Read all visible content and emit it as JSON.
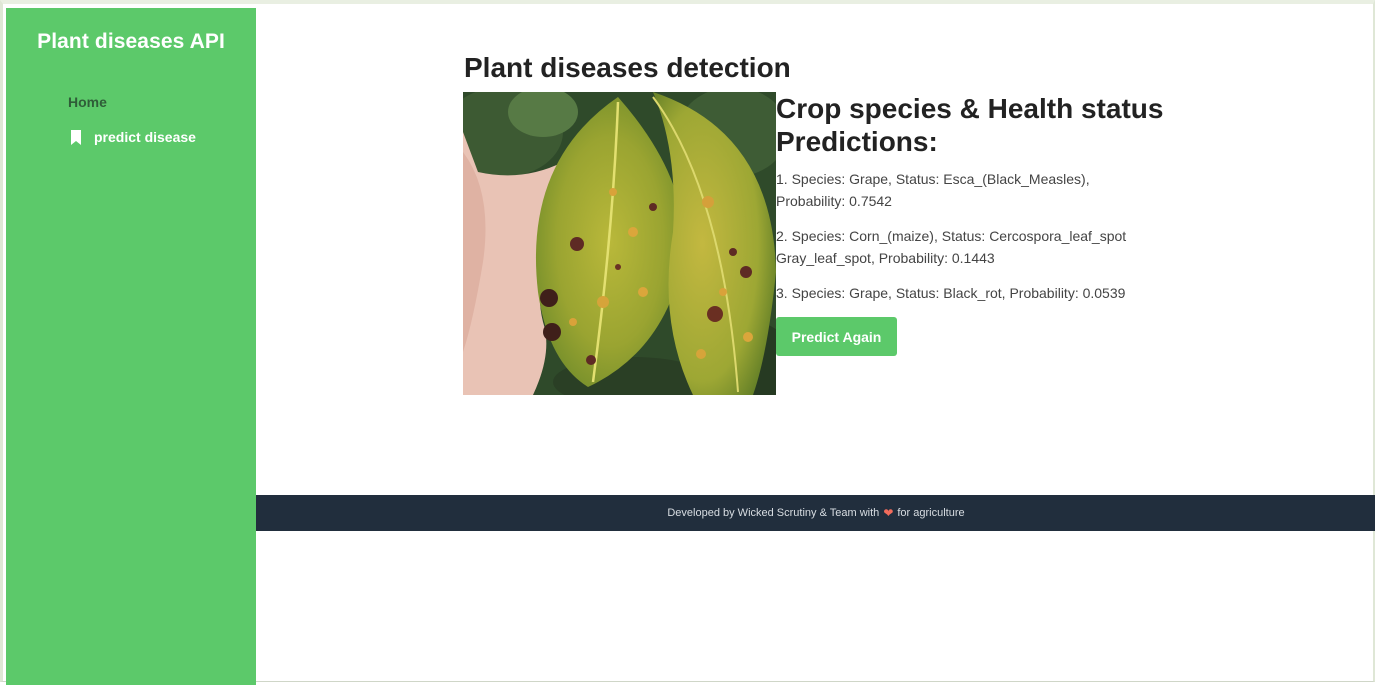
{
  "sidebar": {
    "brand": "Plant diseases API",
    "items": [
      {
        "label": "Home",
        "icon": ""
      },
      {
        "label": "predict disease",
        "icon": "bookmark-icon"
      }
    ]
  },
  "main": {
    "title": "Plant diseases detection",
    "image_alt": "leaf",
    "results_title": "Crop species & Health status Predictions:",
    "predictions": [
      "1. Species: Grape, Status: Esca_(Black_Measles), Probability: 0.7542",
      "2. Species: Corn_(maize), Status: Cercospora_leaf_spot Gray_leaf_spot, Probability: 0.1443",
      "3. Species: Grape, Status: Black_rot, Probability: 0.0539"
    ],
    "predict_again_label": "Predict Again"
  },
  "footer": {
    "text_before": "Developed by Wicked Scrutiny & Team with",
    "heart_icon": "heart-icon",
    "text_after": "for agriculture"
  },
  "colors": {
    "sidebar_bg": "#5cc96a",
    "footer_bg": "#212e3d",
    "heart": "#f26c5c"
  }
}
